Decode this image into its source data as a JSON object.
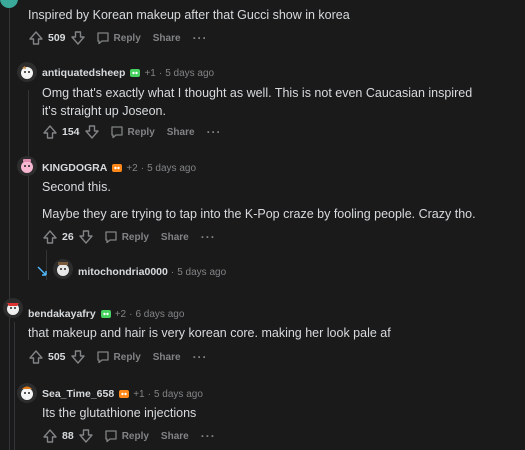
{
  "comments": [
    {
      "text": "Inspired by Korean makeup after that Gucci show in korea",
      "votes": "509",
      "reply_label": "Reply",
      "share_label": "Share"
    },
    {
      "username": "antiquatedsheep",
      "karma": "+1",
      "age": "5 days ago",
      "text": "Omg that's exactly what I thought as well. This is not even Caucasian inspired it's straight up Joseon.",
      "votes": "154",
      "reply_label": "Reply",
      "share_label": "Share"
    },
    {
      "username": "KINGDOGRA",
      "karma": "+2",
      "age": "5 days ago",
      "text_line1": "Second this.",
      "text_line2": "Maybe they are trying to tap into the K-Pop craze by fooling people. Crazy tho.",
      "votes": "26",
      "reply_label": "Reply",
      "share_label": "Share"
    },
    {
      "username": "mitochondria0000",
      "age": "5 days ago"
    },
    {
      "username": "bendakayafry",
      "karma": "+2",
      "age": "6 days ago",
      "text": "that makeup and hair is very korean core. making her look pale af",
      "votes": "505",
      "reply_label": "Reply",
      "share_label": "Share"
    },
    {
      "username": "Sea_Time_658",
      "karma": "+1",
      "age": "5 days ago",
      "text": "Its the glutathione injections",
      "votes": "88",
      "reply_label": "Reply",
      "share_label": "Share"
    }
  ],
  "meta": {
    "separator": "·",
    "more": "···"
  },
  "colors": {
    "background": "#1a1a1b",
    "text": "#d7dadc",
    "muted": "#818384",
    "thread_line": "#343536",
    "flair_green": "#46d160",
    "flair_orange": "#ff8717",
    "collapse_blue": "#4fbcff"
  },
  "icons": [
    "upvote-icon",
    "downvote-icon",
    "comment-icon",
    "more-icon",
    "flair-icon",
    "collapse-icon"
  ]
}
